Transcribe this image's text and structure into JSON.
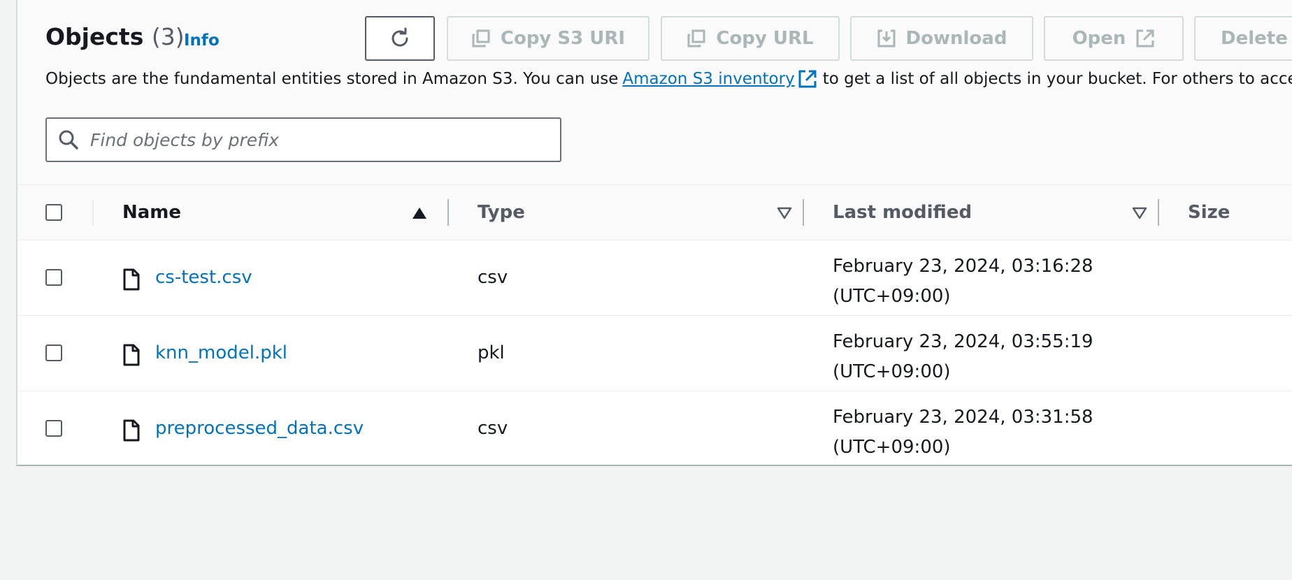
{
  "header": {
    "title": "Objects",
    "count": "(3)",
    "info_label": "Info"
  },
  "toolbar": {
    "refresh_icon": "refresh-icon",
    "copy_s3_uri_label": "Copy S3 URI",
    "copy_url_label": "Copy URL",
    "download_label": "Download",
    "open_label": "Open",
    "delete_label": "Delete"
  },
  "description": {
    "before": "Objects are the fundamental entities stored in Amazon S3. You can use",
    "link": "Amazon S3 inventory",
    "after": "to get a list of all objects in your bucket. For others to access your o"
  },
  "search": {
    "placeholder": "Find objects by prefix"
  },
  "table": {
    "columns": {
      "name": "Name",
      "type": "Type",
      "last_modified": "Last modified",
      "size": "Size"
    },
    "rows": [
      {
        "name": "cs-test.csv",
        "type": "csv",
        "date": "February 23, 2024, 03:16:28",
        "tz": "(UTC+09:00)"
      },
      {
        "name": "knn_model.pkl",
        "type": "pkl",
        "date": "February 23, 2024, 03:55:19",
        "tz": "(UTC+09:00)"
      },
      {
        "name": "preprocessed_data.csv",
        "type": "csv",
        "date": "February 23, 2024, 03:31:58",
        "tz": "(UTC+09:00)"
      }
    ]
  },
  "colors": {
    "link": "#0073bb",
    "text": "#16191f",
    "muted": "#545b64",
    "disabled": "#aab7b8"
  }
}
